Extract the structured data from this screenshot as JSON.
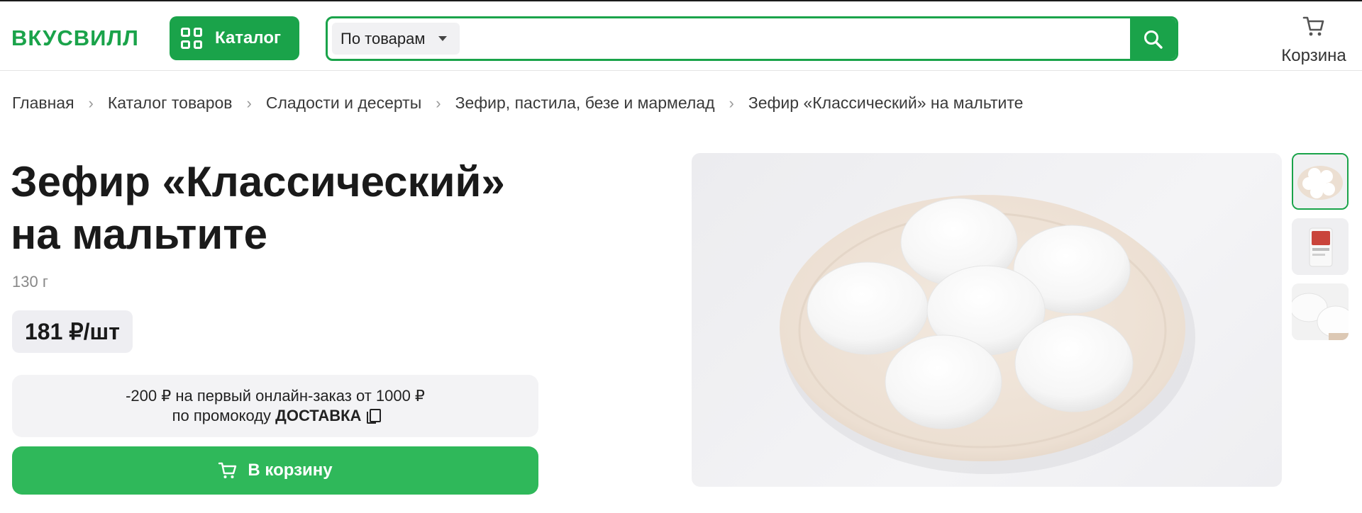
{
  "header": {
    "logo": "ВКУСВИЛЛ",
    "catalog_label": "Каталог",
    "search": {
      "scope": "По товарам",
      "placeholder": ""
    },
    "cart_label": "Корзина"
  },
  "breadcrumbs": [
    "Главная",
    "Каталог товаров",
    "Сладости и десерты",
    "Зефир, пастила, безе и мармелад",
    "Зефир «Классический» на мальтите"
  ],
  "product": {
    "title_line1": "Зефир «Классический»",
    "title_line2": "на мальтите",
    "weight": "130 г",
    "price": "181 ₽/шт",
    "promo_line1": "-200 ₽ на первый онлайн-заказ от 1000 ₽",
    "promo_prefix": "по промокоду",
    "promo_code": "ДОСТАВКА",
    "add_to_cart": "В корзину"
  },
  "gallery": {
    "thumbnail_count": 3,
    "active_index": 0
  },
  "colors": {
    "brand": "#1aa34a",
    "cart_button": "#2fb85a",
    "price_bg": "#eeeef2",
    "promo_bg": "#f3f3f5"
  },
  "icons": [
    "catalog-grid-icon",
    "dropdown-caret-icon",
    "search-icon",
    "cart-icon",
    "chevron-right-icon",
    "copy-icon"
  ]
}
